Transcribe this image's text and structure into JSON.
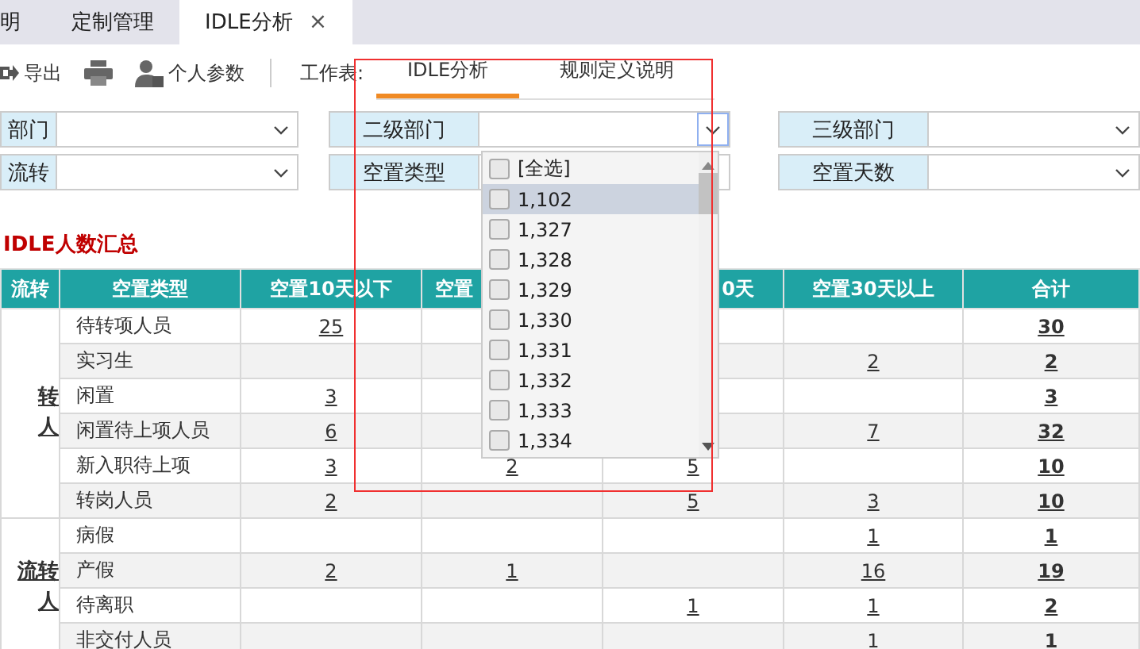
{
  "tabs": [
    {
      "label": "明",
      "selected": false
    },
    {
      "label": "定制管理",
      "selected": false
    },
    {
      "label": "IDLE分析",
      "selected": true,
      "close_label": "×"
    }
  ],
  "toolbar": {
    "buttons": [
      {
        "kind": "export",
        "label": "导出"
      },
      {
        "kind": "print"
      },
      {
        "kind": "user",
        "label": "个人参数"
      }
    ],
    "sheet_label": "工作表:",
    "sheets": [
      {
        "label": "IDLE分析",
        "selected": true
      },
      {
        "label": "规则定义说明",
        "selected": false
      }
    ]
  },
  "filters": [
    [
      {
        "label": "部门",
        "focused": false
      },
      {
        "label": "二级部门",
        "focused": true
      },
      {
        "label": "三级部门",
        "focused": false
      }
    ],
    [
      {
        "label": "流转",
        "focused": false
      },
      {
        "label": "空置类型",
        "focused": false
      },
      {
        "label": "空置天数",
        "focused": false
      }
    ]
  ],
  "report_title": "IDLE人数汇总",
  "table": {
    "columns": [
      "流转",
      "空置类型",
      "空置10天以下",
      "空置",
      "0天",
      "空置30天以上",
      "合计"
    ],
    "groups": [
      {
        "label_lines": [
          "转",
          "人"
        ],
        "rows": [
          {
            "type": "待转项人员",
            "under_10": "25",
            "total": "30"
          },
          {
            "type": "实习生",
            "over_30": "2",
            "total": "2"
          },
          {
            "type": "闲置",
            "under_10": "3",
            "total": "3"
          },
          {
            "type": "闲置待上项人员",
            "under_10": "6",
            "over_30": "7",
            "total": "32"
          },
          {
            "type": "新入职待上项",
            "under_10": "3",
            "column_4": "2",
            "column_5": "5",
            "total": "10"
          },
          {
            "type": "转岗人员",
            "under_10": "2",
            "column_5": "5",
            "over_30": "3",
            "total": "10"
          }
        ]
      },
      {
        "label_lines": [
          "流转",
          "人"
        ],
        "rows": [
          {
            "type": "病假",
            "over_30": "1",
            "total": "1"
          },
          {
            "type": "产假",
            "under_10": "2",
            "column_4": "1",
            "over_30": "16",
            "total": "19"
          },
          {
            "type": "待离职",
            "column_5": "1",
            "over_30": "1",
            "total": "2"
          },
          {
            "type": "非交付人员",
            "over_30": "1",
            "total": "1"
          }
        ]
      }
    ]
  },
  "dropdown": {
    "items": [
      {
        "label": "[全选]",
        "checked": false,
        "highlighted": false
      },
      {
        "label": "1,102",
        "checked": false,
        "highlighted": true
      },
      {
        "label": "1,327",
        "checked": false,
        "highlighted": false
      },
      {
        "label": "1,328",
        "checked": false,
        "highlighted": false
      },
      {
        "label": "1,329",
        "checked": false,
        "highlighted": false
      },
      {
        "label": "1,330",
        "checked": false,
        "highlighted": false
      },
      {
        "label": "1,331",
        "checked": false,
        "highlighted": false
      },
      {
        "label": "1,332",
        "checked": false,
        "highlighted": false
      },
      {
        "label": "1,333",
        "checked": false,
        "highlighted": false
      },
      {
        "label": "1,334",
        "checked": false,
        "highlighted": false
      }
    ]
  }
}
